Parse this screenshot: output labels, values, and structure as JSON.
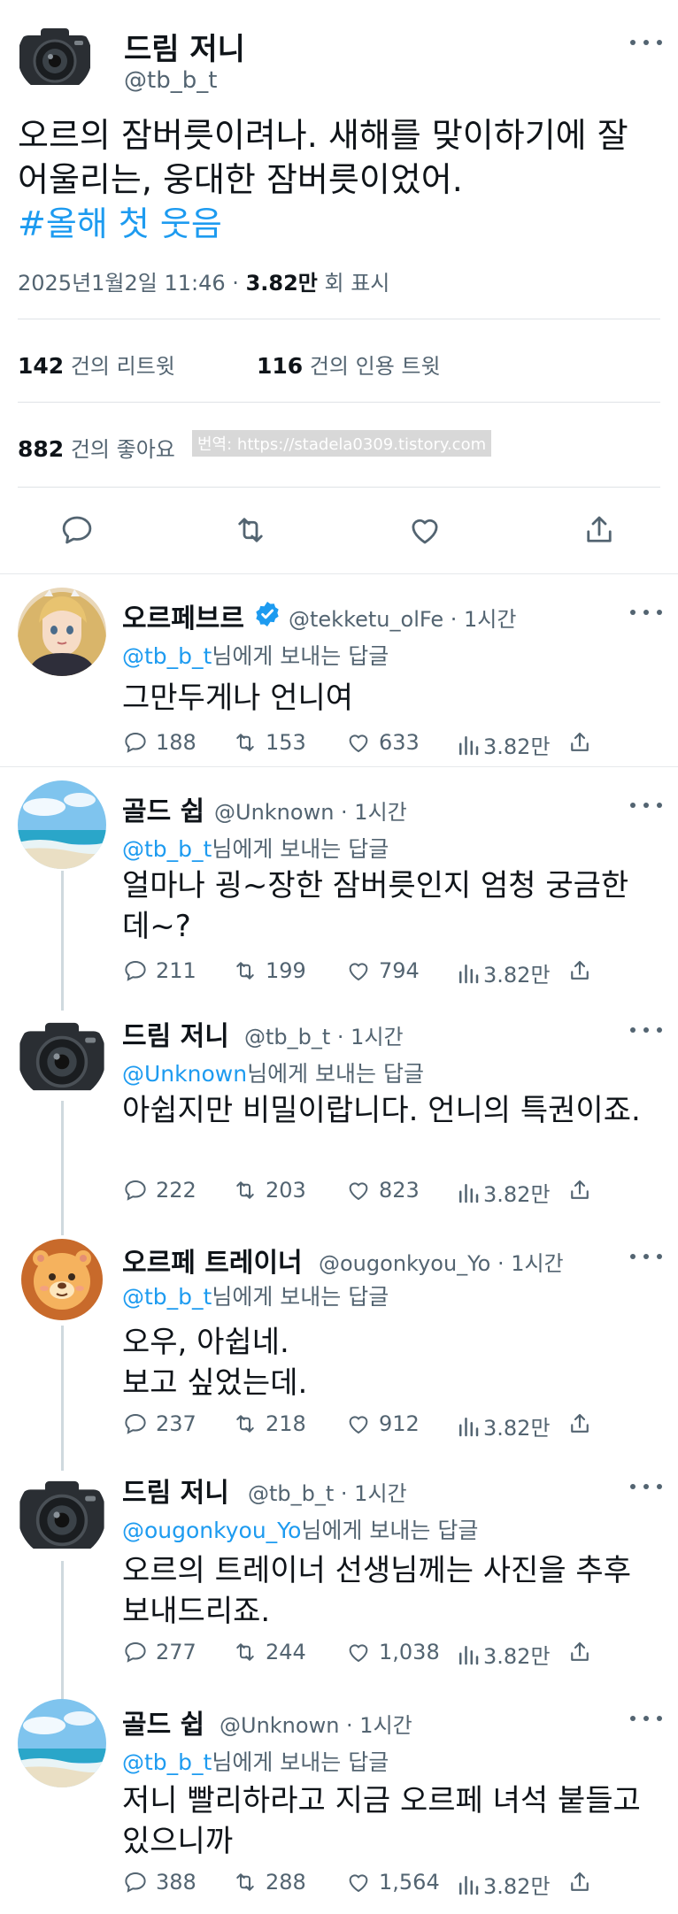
{
  "main_tweet": {
    "author_name": "드림 저니",
    "handle": "@tb_b_t",
    "text": "오르의 잠버릇이려나. 새해를 맞이하기에 잘 어울리는, 웅대한 잠버릇이었어.",
    "hashtag": "#올해 첫 웃음",
    "timestamp": "2025년1월2일 11:46",
    "dot": "·",
    "views_value": "3.82만",
    "views_label": "회 표시",
    "retweets_value": "142",
    "retweets_label": "건의 리트윗",
    "quotes_value": "116",
    "quotes_label": "건의 인용 트윗",
    "likes_value": "882",
    "likes_label": "건의 좋아요",
    "watermark": "번역: https://stadela0309.tistory.com"
  },
  "replies": [
    {
      "name": "오르페브르",
      "handle": "@tekketu_olFe · 1시간",
      "verified": true,
      "mention": "@tb_b_t",
      "reply_suffix": "님에게 보내는 답글",
      "text": "그만두게나 언니여",
      "comments": "188",
      "retweets": "153",
      "likes": "633",
      "views": "3.82만"
    },
    {
      "name": "골드 쉽",
      "handle": "@Unknown · 1시간",
      "mention": "@tb_b_t",
      "reply_suffix": "님에게 보내는 답글",
      "text": "얼마나 굉~장한 잠버릇인지 엄청 궁금한데~?",
      "comments": "211",
      "retweets": "199",
      "likes": "794",
      "views": "3.82만"
    },
    {
      "name": "드림 저니",
      "handle": "@tb_b_t · 1시간",
      "mention": "@Unknown",
      "reply_suffix": "님에게 보내는 답글",
      "text": "아쉽지만 비밀이랍니다. 언니의 특권이죠.",
      "comments": "222",
      "retweets": "203",
      "likes": "823",
      "views": "3.82만"
    },
    {
      "name": "오르페 트레이너",
      "handle": "@ougonkyou_Yo · 1시간",
      "mention": "@tb_b_t",
      "reply_suffix": "님에게 보내는 답글",
      "text_line1": "오우, 아쉽네.",
      "text_line2": "보고 싶었는데.",
      "comments": "237",
      "retweets": "218",
      "likes": "912",
      "views": "3.82만"
    },
    {
      "name": "드림 저니",
      "handle": "@tb_b_t · 1시간",
      "mention": "@ougonkyou_Yo",
      "reply_suffix": "님에게 보내는 답글",
      "text": "오르의 트레이너 선생님께는 사진을 추후 보내드리죠.",
      "comments": "277",
      "retweets": "244",
      "likes": "1,038",
      "views": "3.82만"
    },
    {
      "name": "골드 쉽",
      "handle": "@Unknown · 1시간",
      "mention": "@tb_b_t",
      "reply_suffix": "님에게 보내는 답글",
      "text": "저니 빨리하라고 지금 오르페 녀석 붙들고 있으니까",
      "comments": "388",
      "retweets": "288",
      "likes": "1,564",
      "views": "3.82만"
    }
  ],
  "colors": {
    "accent": "#1d9bf0",
    "secondary_text": "#536471",
    "divider": "#dfe3e6"
  },
  "icons": [
    "camera-avatar",
    "blonde-avatar",
    "beach-avatar",
    "lion-avatar",
    "more-icon",
    "verified-icon",
    "comment-icon",
    "retweet-icon",
    "like-icon",
    "views-icon",
    "share-icon"
  ]
}
